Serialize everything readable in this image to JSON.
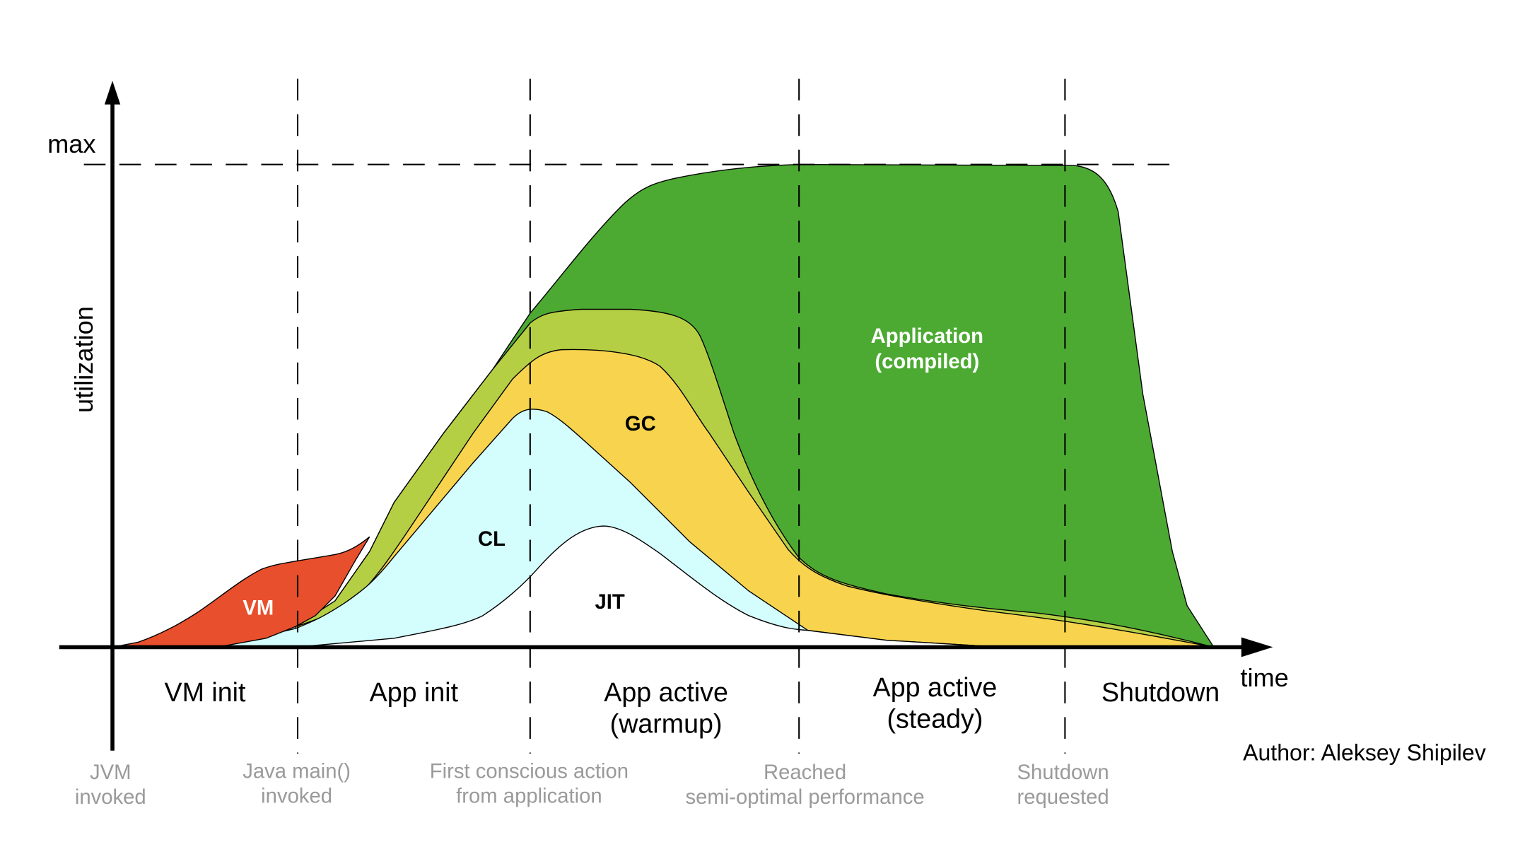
{
  "chart_data": {
    "type": "area",
    "ylabel": "utilization",
    "xlabel": "time",
    "y_max_label": "max",
    "stacked": true,
    "series": [
      {
        "name": "VM",
        "color": "#e84f2c"
      },
      {
        "name": "JIT",
        "color": "#ffffff"
      },
      {
        "name": "CL",
        "color": "#d4fdfd"
      },
      {
        "name": "GC",
        "color": "#f8d44e"
      },
      {
        "name": "",
        "color": "#b5cf44"
      },
      {
        "name": "Application (compiled)",
        "color": "#4caa32"
      }
    ],
    "labels": {
      "vm": "VM",
      "jit": "JIT",
      "cl": "CL",
      "gc": "GC",
      "app_line1": "Application",
      "app_line2": "(compiled)"
    },
    "phases": [
      {
        "line1": "VM init",
        "line2": ""
      },
      {
        "line1": "App init",
        "line2": ""
      },
      {
        "line1": "App active",
        "line2": "(warmup)"
      },
      {
        "line1": "App active",
        "line2": "(steady)"
      },
      {
        "line1": "Shutdown",
        "line2": ""
      }
    ],
    "milestones": [
      {
        "line1": "JVM",
        "line2": "invoked"
      },
      {
        "line1": "Java main()",
        "line2": "invoked"
      },
      {
        "line1": "First conscious action",
        "line2": "from application"
      },
      {
        "line1": "Reached",
        "line2": "semi-optimal performance"
      },
      {
        "line1": "Shutdown",
        "line2": "requested"
      }
    ],
    "grid": false
  },
  "author": "Author: Aleksey Shipilev"
}
